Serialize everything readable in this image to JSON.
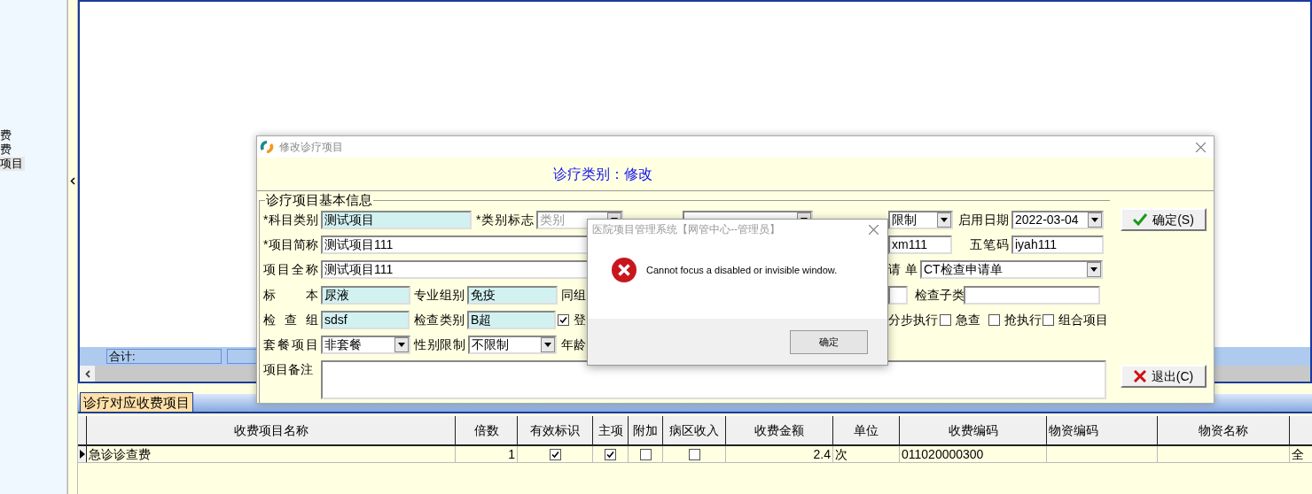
{
  "tree": {
    "items": [
      {
        "label": "费",
        "selected": false
      },
      {
        "label": "费",
        "selected": false
      },
      {
        "label": "项目",
        "selected": true
      }
    ]
  },
  "main_grid": {
    "totals_label": "合计:"
  },
  "bottom_tabs": [
    {
      "label": "诊疗对应收费项目",
      "selected": true
    }
  ],
  "charge_table": {
    "columns": [
      {
        "label": "收费项目名称",
        "kind": "text"
      },
      {
        "label": "倍数",
        "kind": "number"
      },
      {
        "label": "有效标识",
        "kind": "check"
      },
      {
        "label": "主项",
        "kind": "check"
      },
      {
        "label": "附加",
        "kind": "check"
      },
      {
        "label": "病区收入",
        "kind": "check"
      },
      {
        "label": "收费金额",
        "kind": "number"
      },
      {
        "label": "单位",
        "kind": "text"
      },
      {
        "label": "收费编码",
        "kind": "text"
      },
      {
        "label": "物资编码",
        "kind": "text"
      },
      {
        "label": "物资名称",
        "kind": "text"
      },
      {
        "kind": "text"
      }
    ],
    "rows": [
      {
        "current": true,
        "cells": [
          "急诊诊查费",
          "1",
          true,
          true,
          false,
          false,
          "2.4",
          "次",
          "011020000300",
          "",
          "",
          "全"
        ]
      }
    ]
  },
  "edit_dialog": {
    "title": "修改诊疗项目",
    "heading": "诊疗类别：修改",
    "group_title": "诊疗项目基本信息",
    "fields": [
      {
        "kind": "input",
        "label": "*科目类别",
        "value": "测试项目",
        "highlighted": true
      },
      {
        "kind": "select",
        "label": "*类别标志",
        "value": "类别",
        "disabled": true
      },
      {
        "kind": "select"
      },
      {
        "kind": "select",
        "value": "限制",
        "disabled": false
      },
      {
        "kind": "select",
        "label": "启用日期",
        "value": "2022-03-04",
        "disabled": false
      },
      {
        "kind": "input",
        "label": "*项目简称",
        "value": "测试项目111",
        "highlighted": false
      },
      {
        "kind": "input",
        "value": "xm111",
        "highlighted": false
      },
      {
        "kind": "input",
        "label": "五笔码",
        "value": "iyah111",
        "highlighted": false
      },
      {
        "kind": "input",
        "label": "项目全称",
        "value": "测试项目111",
        "highlighted": false
      },
      {
        "kind": "select",
        "label": "请单",
        "value": "CT检查申请单",
        "disabled": false
      },
      {
        "kind": "input",
        "label": "标 本",
        "value": "尿液",
        "highlighted": true
      },
      {
        "kind": "input",
        "label": "专业组别",
        "value": "免疫",
        "highlighted": true
      },
      {
        "kind": "label",
        "label": "同组"
      },
      {
        "kind": "input",
        "highlighted": false
      },
      {
        "kind": "input",
        "label": "检查子类",
        "highlighted": false
      },
      {
        "kind": "input",
        "label": "检 查 组",
        "value": "sdsf",
        "highlighted": true
      },
      {
        "kind": "input",
        "label": "检查类别",
        "value": "B超",
        "highlighted": true
      },
      {
        "kind": "check",
        "label": "登",
        "checked": true
      },
      {
        "kind": "label",
        "label": "分步执行"
      },
      {
        "kind": "check",
        "label": "急查",
        "checked": false
      },
      {
        "kind": "check",
        "label": "抢执行",
        "checked": false
      },
      {
        "kind": "check",
        "label": "组合项目",
        "checked": false
      },
      {
        "kind": "select",
        "label": "套餐项目",
        "value": "非套餐",
        "disabled": false
      },
      {
        "kind": "select",
        "label": "性别限制",
        "value": "不限制",
        "disabled": false
      },
      {
        "kind": "label",
        "label": "年龄"
      }
    ],
    "memo_label": "项目备注",
    "buttons": [
      {
        "kind": "ok",
        "label": "确定(S)"
      },
      {
        "kind": "cancel",
        "label": "退出(C)"
      }
    ]
  },
  "message_box": {
    "title": "医院项目管理系统【网管中心--管理员】",
    "message": "Cannot focus a disabled or invisible window.",
    "button": "确定"
  }
}
